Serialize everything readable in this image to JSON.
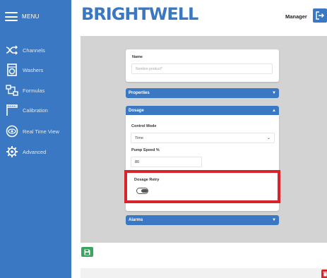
{
  "sidebar": {
    "menu_label": "MENU",
    "items": [
      {
        "label": "Channels",
        "icon": "channels-icon"
      },
      {
        "label": "Washers",
        "icon": "washer-icon"
      },
      {
        "label": "Formulas",
        "icon": "formulas-icon"
      },
      {
        "label": "Calibration",
        "icon": "calibration-icon"
      },
      {
        "label": "Real Time View",
        "icon": "eye-icon"
      },
      {
        "label": "Advanced",
        "icon": "gear-icon"
      }
    ]
  },
  "header": {
    "brand": "BRIGHTWELL",
    "user": "Manager",
    "logout_icon": "logout-icon"
  },
  "form": {
    "name_label": "Name",
    "name_placeholder": "Nombre product*",
    "name_value": "",
    "properties_label": "Properties",
    "dosage_label": "Dosage",
    "control_mode_label": "Control Mode",
    "control_mode_value": "Time",
    "pump_speed_label": "Pump Speed %",
    "pump_speed_value": "80",
    "dosage_retry_label": "Dosage Retry",
    "dosage_retry_on": false,
    "alarms_label": "Alarms"
  },
  "colors": {
    "primary": "#3a78c3",
    "highlight": "#d8232a",
    "save": "#3aa55f",
    "delete": "#d8232a"
  }
}
